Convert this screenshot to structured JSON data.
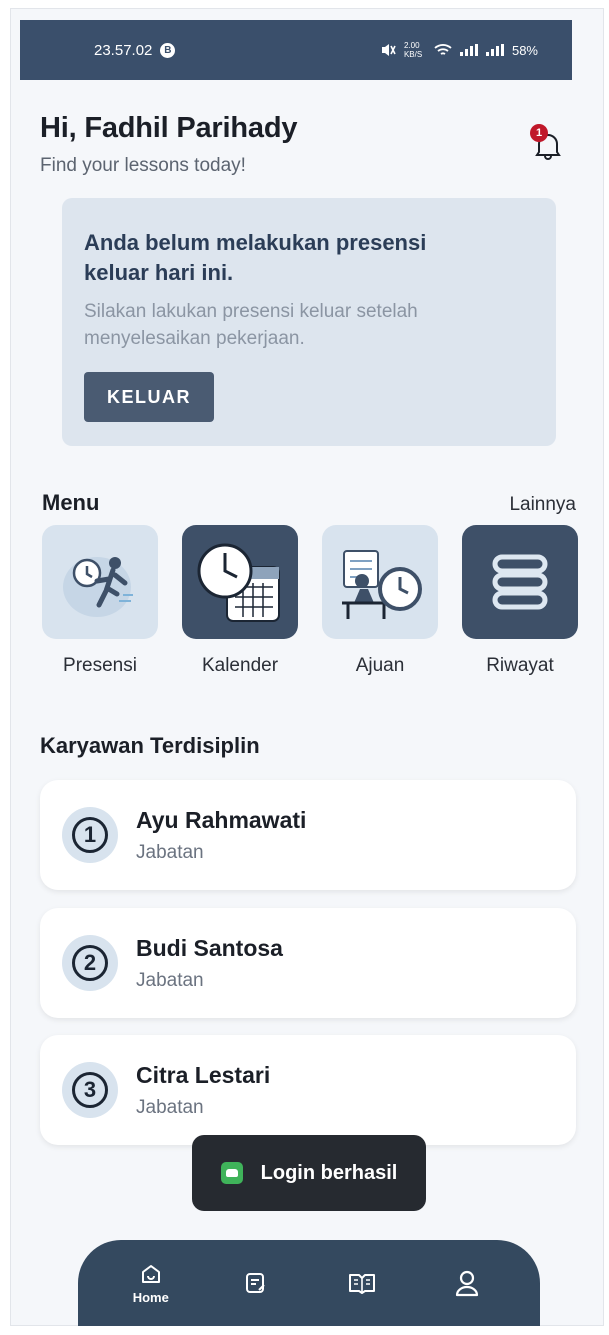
{
  "status_bar": {
    "time": "23.57.02",
    "notif_glyph": "B",
    "net_speed": "2.00 KB/S",
    "battery": "58%"
  },
  "header": {
    "greeting": "Hi, Fadhil Parihady",
    "subtitle": "Find your lessons today!",
    "notification_count": "1"
  },
  "alert": {
    "title": "Anda belum melakukan presensi keluar hari ini.",
    "message": "Silakan lakukan presensi keluar setelah menyelesaikan pekerjaan.",
    "button_label": "KELUAR"
  },
  "menu": {
    "title": "Menu",
    "more_label": "Lainnya",
    "items": [
      {
        "label": "Presensi",
        "icon": "running-clock-icon"
      },
      {
        "label": "Kalender",
        "icon": "calendar-clock-icon"
      },
      {
        "label": "Ajuan",
        "icon": "desk-clock-icon"
      },
      {
        "label": "Riwayat",
        "icon": "stack-icon"
      }
    ]
  },
  "top_employees": {
    "title": "Karyawan Terdisiplin",
    "list": [
      {
        "rank": "1",
        "name": "Ayu Rahmawati",
        "position": "Jabatan"
      },
      {
        "rank": "2",
        "name": "Budi Santosa",
        "position": "Jabatan"
      },
      {
        "rank": "3",
        "name": "Citra Lestari",
        "position": "Jabatan"
      }
    ]
  },
  "toast": {
    "message": "Login berhasil"
  },
  "bottom_nav": {
    "items": [
      {
        "label": "Home",
        "icon": "home-icon",
        "active": true
      },
      {
        "label": "",
        "icon": "notes-icon",
        "active": false
      },
      {
        "label": "",
        "icon": "book-icon",
        "active": false
      },
      {
        "label": "",
        "icon": "user-icon",
        "active": false
      }
    ]
  },
  "colors": {
    "primary": "#3a4f6b",
    "alert_bg": "#dde5ee",
    "badge": "#c0182a",
    "toast_bg": "#262a30"
  }
}
